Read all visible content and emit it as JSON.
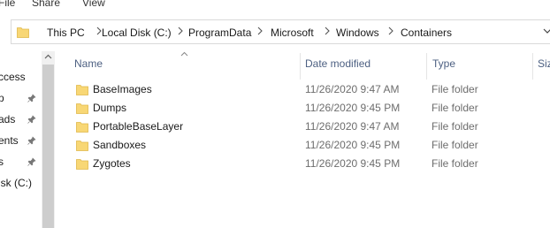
{
  "ribbon": {
    "tabs": [
      "File",
      "Share",
      "View"
    ]
  },
  "address_bar": {
    "breadcrumbs": [
      "This PC",
      "Local Disk (C:)",
      "ProgramData",
      "Microsoft",
      "Windows",
      "Containers"
    ]
  },
  "nav_pane": {
    "items": [
      {
        "label": "ccess",
        "pinned": false
      },
      {
        "label": "p",
        "pinned": true
      },
      {
        "label": "ads",
        "pinned": true
      },
      {
        "label": "ents",
        "pinned": true
      },
      {
        "label": "s",
        "pinned": true
      },
      {
        "label": "isk (C:)",
        "pinned": false
      }
    ]
  },
  "columns": {
    "name": "Name",
    "date_modified": "Date modified",
    "type": "Type",
    "size": "Siz"
  },
  "files": [
    {
      "name": "BaseImages",
      "date": "11/26/2020 9:47 AM",
      "type": "File folder"
    },
    {
      "name": "Dumps",
      "date": "11/26/2020 9:45 PM",
      "type": "File folder"
    },
    {
      "name": "PortableBaseLayer",
      "date": "11/26/2020 9:47 AM",
      "type": "File folder"
    },
    {
      "name": "Sandboxes",
      "date": "11/26/2020 9:45 PM",
      "type": "File folder"
    },
    {
      "name": "Zygotes",
      "date": "11/26/2020 9:45 PM",
      "type": "File folder"
    }
  ],
  "icons": {
    "folder": "folder-icon",
    "pin": "pin-icon",
    "breadcrumb_separator": "chevron-right-icon",
    "address_dropdown": "chevron-down-icon",
    "sort": "sort-up-icon"
  },
  "colors": {
    "folder": "#f8d775",
    "folder_dark": "#e0b84a",
    "header_text": "#4d6082",
    "secondary_text": "#6d6d6d"
  }
}
